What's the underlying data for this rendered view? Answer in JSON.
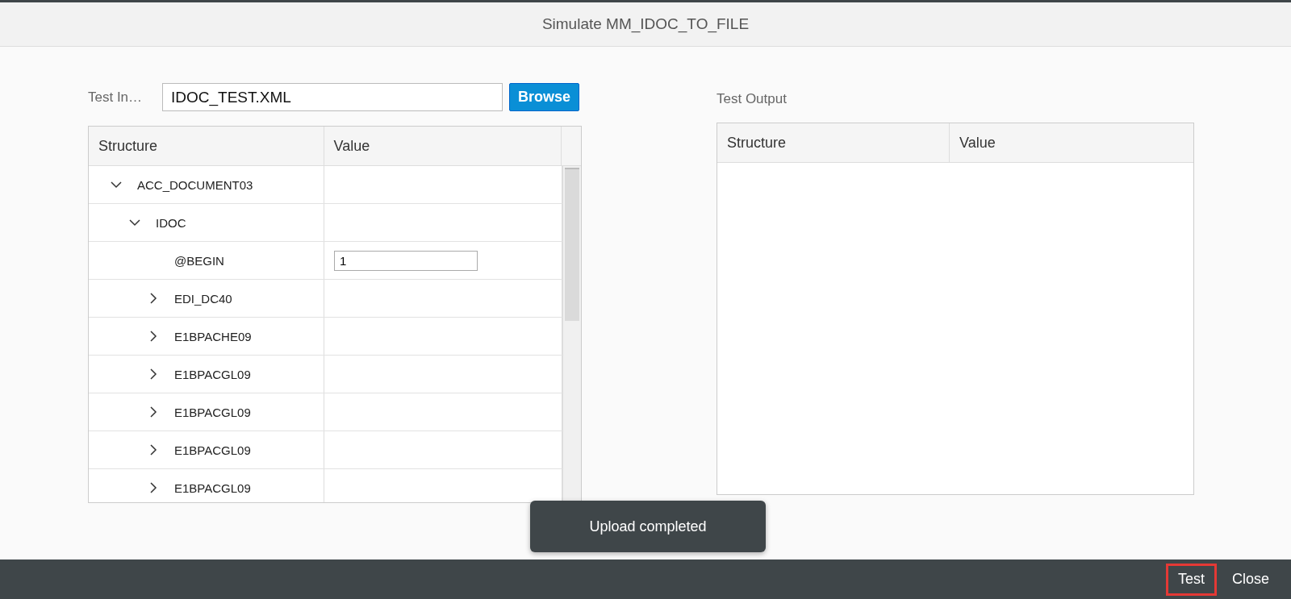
{
  "dialog": {
    "title": "Simulate MM_IDOC_TO_FILE"
  },
  "test_input": {
    "label": "Test In…",
    "value": "IDOC_TEST.XML",
    "browse_button": "Browse"
  },
  "input_table": {
    "columns": [
      "Structure",
      "Value"
    ],
    "rows": [
      {
        "name": "ACC_DOCUMENT03",
        "expanded": true,
        "children": [
          {
            "name": "IDOC",
            "expanded": true,
            "children": [
              {
                "name": "@BEGIN",
                "value": "1"
              },
              {
                "name": "EDI_DC40",
                "expanded": false
              },
              {
                "name": "E1BPACHE09",
                "expanded": false
              },
              {
                "name": "E1BPACGL09",
                "expanded": false
              },
              {
                "name": "E1BPACGL09",
                "expanded": false
              },
              {
                "name": "E1BPACGL09",
                "expanded": false
              },
              {
                "name": "E1BPACGL09",
                "expanded": false
              }
            ]
          }
        ]
      }
    ]
  },
  "test_output": {
    "label": "Test Output",
    "columns": [
      "Structure",
      "Value"
    ]
  },
  "toast": "Upload completed",
  "footer_buttons": [
    {
      "label": "Test",
      "highlighted": true
    },
    {
      "label": "Close",
      "highlighted": false
    }
  ]
}
